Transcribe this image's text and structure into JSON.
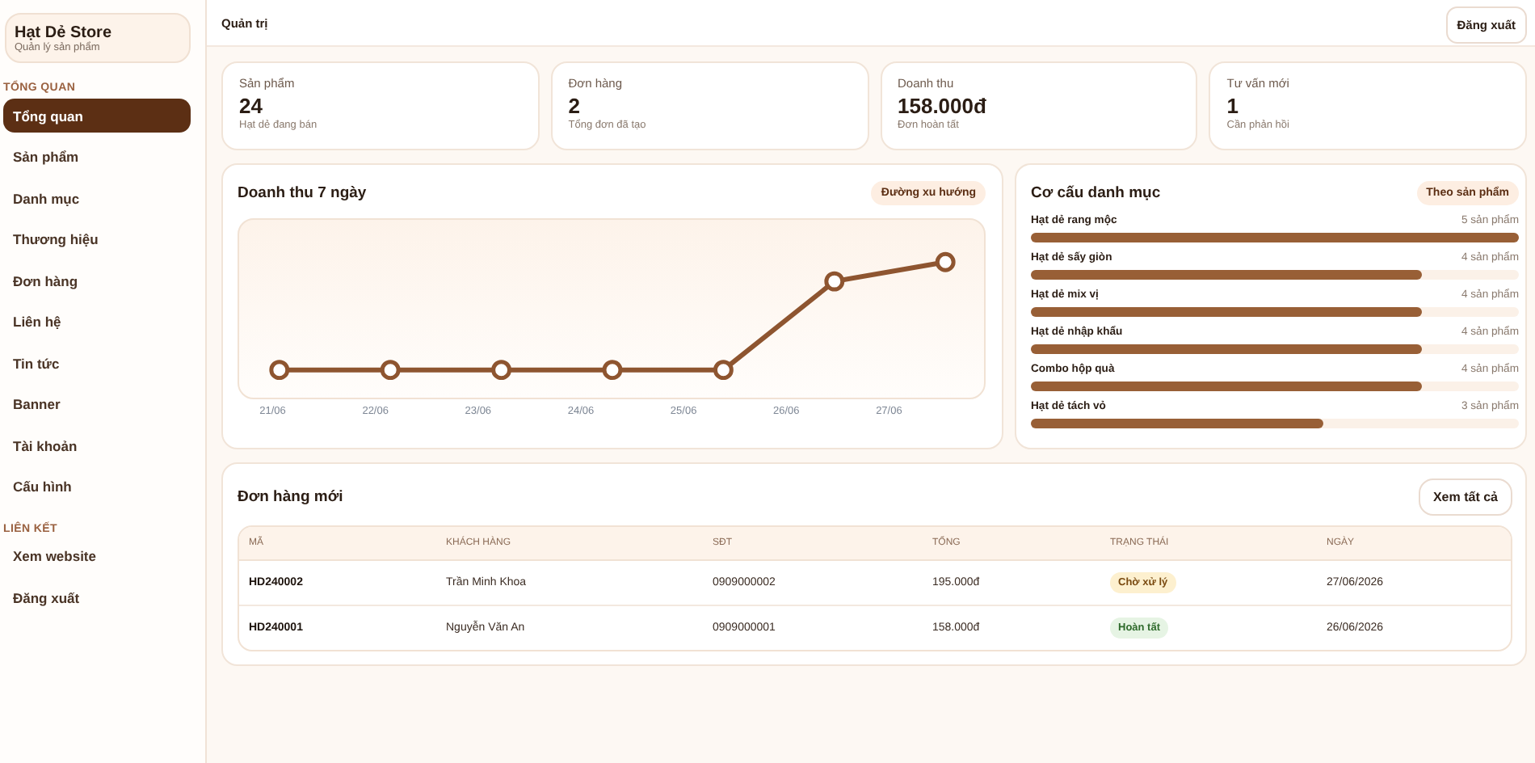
{
  "sidebar": {
    "brand": {
      "title": "Hạt Dẻ Store",
      "subtitle": "Quản lý sản phẩm"
    },
    "sections": [
      {
        "label": "TỔNG QUAN",
        "items": [
          {
            "label": "Tổng quan",
            "selected": true
          },
          {
            "label": "Sản phẩm",
            "selected": false
          },
          {
            "label": "Danh mục",
            "selected": false
          },
          {
            "label": "Thương hiệu",
            "selected": false
          },
          {
            "label": "Đơn hàng",
            "selected": false
          },
          {
            "label": "Liên hệ",
            "selected": false
          },
          {
            "label": "Tin tức",
            "selected": false
          },
          {
            "label": "Banner",
            "selected": false
          },
          {
            "label": "Tài khoản",
            "selected": false
          },
          {
            "label": "Cấu hình",
            "selected": false
          }
        ]
      },
      {
        "label": "LIÊN KẾT",
        "items": [
          {
            "label": "Xem website",
            "selected": false
          },
          {
            "label": "Đăng xuất",
            "selected": false
          }
        ]
      }
    ]
  },
  "topbar": {
    "title": "Quản trị",
    "logout": "Đăng xuất"
  },
  "stats": [
    {
      "label": "Sản phẩm",
      "value": "24",
      "note": "Hạt dẻ đang bán"
    },
    {
      "label": "Đơn hàng",
      "value": "2",
      "note": "Tổng đơn đã tạo"
    },
    {
      "label": "Doanh thu",
      "value": "158.000đ",
      "note": "Đơn hoàn tất"
    },
    {
      "label": "Tư vấn mới",
      "value": "1",
      "note": "Cần phản hồi"
    }
  ],
  "revenue": {
    "title": "Doanh thu 7 ngày",
    "badge": "Đường xu hướng",
    "x_labels": [
      "21/06",
      "22/06",
      "23/06",
      "24/06",
      "25/06",
      "26/06",
      "27/06"
    ]
  },
  "categories": {
    "title": "Cơ cấu danh mục",
    "badge": "Theo sản phẩm",
    "items": [
      {
        "name": "Hạt dẻ rang mộc",
        "count": "5 sản phẩm",
        "level": 1
      },
      {
        "name": "Hạt dẻ sấy giòn",
        "count": "4 sản phẩm",
        "level": 0.8
      },
      {
        "name": "Hạt dẻ mix vị",
        "count": "4 sản phẩm",
        "level": 0.8
      },
      {
        "name": "Hạt dẻ nhập khẩu",
        "count": "4 sản phẩm",
        "level": 0.8
      },
      {
        "name": "Combo hộp quà",
        "count": "4 sản phẩm",
        "level": 0.8
      },
      {
        "name": "Hạt dẻ tách vỏ",
        "count": "3 sản phẩm",
        "level": 0.6
      }
    ]
  },
  "orders": {
    "title": "Đơn hàng mới",
    "button": "Xem tất cả",
    "columns": [
      "MÃ",
      "KHÁCH HÀNG",
      "SĐT",
      "TỔNG",
      "TRẠNG THÁI",
      "NGÀY"
    ],
    "rows": [
      {
        "code": "HD240002",
        "customer": "Trần Minh Khoa",
        "phone": "0909000002",
        "total": "195.000đ",
        "status": {
          "label": "Chờ xử lý",
          "kind": "pending"
        },
        "date": "27/06/2026"
      },
      {
        "code": "HD240001",
        "customer": "Nguyễn Văn An",
        "phone": "0909000001",
        "total": "158.000đ",
        "status": {
          "label": "Hoàn tất",
          "kind": "done"
        },
        "date": "26/06/2026"
      }
    ]
  }
}
